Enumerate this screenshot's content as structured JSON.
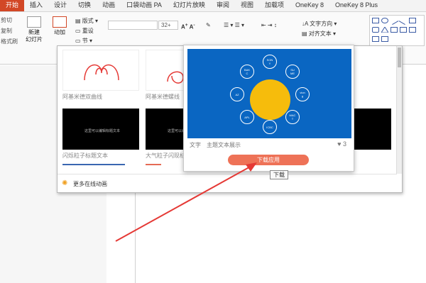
{
  "ribbon_tabs": [
    "开始",
    "插入",
    "设计",
    "切换",
    "动画",
    "口袋动画 PA",
    "幻灯片放映",
    "审阅",
    "视图",
    "加载项",
    "OneKey 8",
    "OneKey 8 Plus"
  ],
  "ribbon": {
    "clipboard_items": [
      "剪切",
      "复制",
      "格式刷"
    ],
    "new_slide_label": "新建\n幻灯片",
    "add_label": "动加",
    "layout_label": "版式",
    "reset_label": "重设",
    "section_label": "节",
    "font_size": "32+",
    "text_direction_label": "文字方向",
    "align_text_label": "对齐文本"
  },
  "gallery": {
    "cards": [
      {
        "label": "阿基米德双曲线",
        "style": "light"
      },
      {
        "label": "阿基米德螺线",
        "style": "light"
      },
      {
        "label": "闪烁粒子标题文本",
        "style": "dark",
        "inner_text": "这里可以编辑标题文本"
      },
      {
        "label": "大气粒子闪现标",
        "style": "dark",
        "inner_text": "这里可以编辑文本"
      }
    ],
    "footer_label": "更多在线动画"
  },
  "preview": {
    "nodes": [
      "SON\nY",
      "SU\nME",
      "vion\ng",
      "MAC\nT",
      "ICBC",
      "APL",
      "AZ",
      "BAK\nC"
    ],
    "category": "文字",
    "description": "主题文本展示",
    "likes": "3",
    "download_label": "下载应用",
    "tooltip": "下载"
  },
  "colors": {
    "accent_red": "#d24726",
    "preview_blue": "#0a66c2",
    "sun_yellow": "#f6bc0c",
    "download_btn": "#ee7257",
    "arrow_red": "#e53935"
  }
}
